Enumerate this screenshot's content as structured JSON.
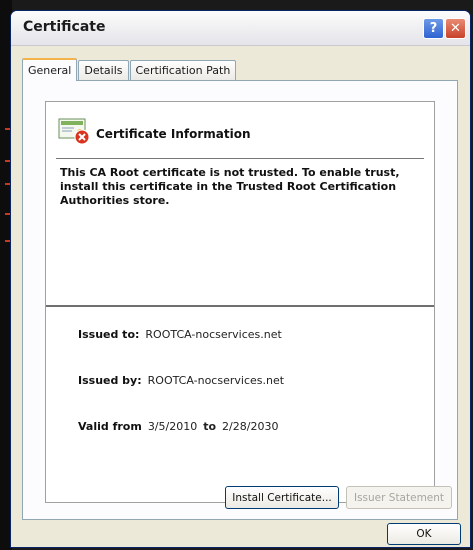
{
  "window": {
    "title": "Certificate",
    "help_label": "?",
    "close_label": "✕"
  },
  "tabs": [
    {
      "label": "General",
      "active": true
    },
    {
      "label": "Details",
      "active": false
    },
    {
      "label": "Certification Path",
      "active": false
    }
  ],
  "general": {
    "info_title": "Certificate Information",
    "warning": "This CA Root certificate is not trusted. To enable trust, install this certificate in the Trusted Root Certification Authorities store.",
    "issued_to_label": "Issued to:",
    "issued_to_value": "ROOTCA-nocservices.net",
    "issued_by_label": "Issued by:",
    "issued_by_value": "ROOTCA-nocservices.net",
    "valid_from_label": "Valid from",
    "valid_from_value": "3/5/2010",
    "valid_to_label": "to",
    "valid_to_value": "2/28/2030",
    "install_button": "Install Certificate...",
    "issuer_statement_button": "Issuer Statement"
  },
  "footer": {
    "ok_button": "OK"
  },
  "colors": {
    "title_bar": "#f1f1f3",
    "window_bg": "#ece9d8",
    "tab_highlight": "#f3b24a",
    "error_red": "#d9321e"
  }
}
